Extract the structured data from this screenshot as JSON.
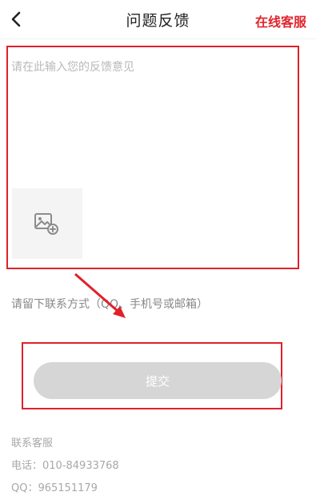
{
  "header": {
    "title": "问题反馈",
    "online_service_label": "在线客服",
    "back_icon": "chevron-left-icon"
  },
  "feedback": {
    "placeholder": "请在此输入您的反馈意见",
    "image_upload_icon": "add-image-icon"
  },
  "contact": {
    "placeholder": "请留下联系方式（QQ、手机号或邮箱）"
  },
  "submit": {
    "label": "提交"
  },
  "service_info": {
    "heading": "联系客服",
    "phone": "电话：010-84933768",
    "qq": "QQ：965151179"
  },
  "colors": {
    "accent_red": "#e1252d",
    "annotation_red": "#e0212a",
    "button_disabled": "#d6d6d6"
  }
}
